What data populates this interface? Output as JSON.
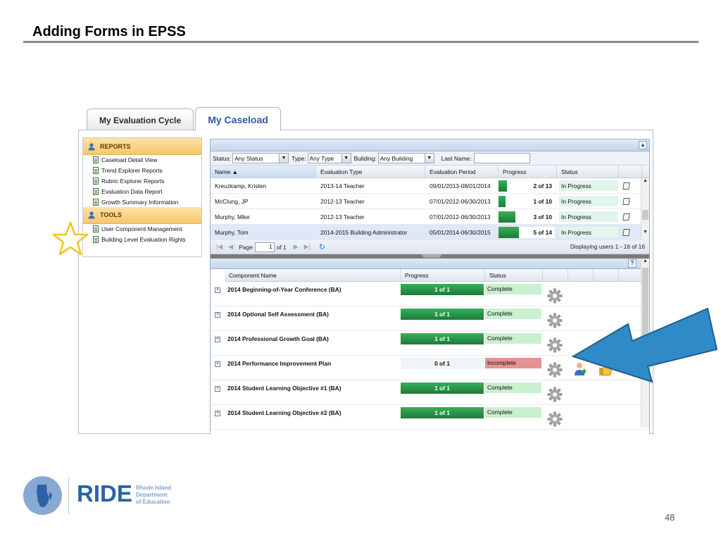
{
  "slide": {
    "title": "Adding Forms in EPSS",
    "page_number": "48"
  },
  "tabs": [
    {
      "label": "My Evaluation Cycle",
      "active": false
    },
    {
      "label": "My Caseload",
      "active": true
    }
  ],
  "sidebar": {
    "reports_header": "REPORTS",
    "reports": [
      "Caseload Detail View",
      "Trend Explorer Reports",
      "Rubric Explorer Reports",
      "Evaluation Data Report",
      "Growth Summary Information"
    ],
    "tools_header": "TOOLS",
    "tools": [
      "User Component Management",
      "Building Level Evaluation Rights"
    ]
  },
  "filters": {
    "status_label": "Status:",
    "status_value": "Any Status",
    "type_label": "Type:",
    "type_value": "Any Type",
    "building_label": "Building:",
    "building_value": "Any Building",
    "lastname_label": "Last Name:"
  },
  "caseload": {
    "columns": [
      "Name ▲",
      "Evaluation Type",
      "Evaluation Period",
      "Progress",
      "Status"
    ],
    "rows": [
      {
        "name": "Kreuzkamp, Kristen",
        "type": "2013-14 Teacher",
        "period": "09/01/2013-08/01/2014",
        "progress": "2 of 13",
        "progress_fraction": 0.154,
        "status": "In Progress"
      },
      {
        "name": "McClung, JP",
        "type": "2012-13 Teacher",
        "period": "07/01/2012-06/30/2013",
        "progress": "1 of 10",
        "progress_fraction": 0.1,
        "status": "In Progress"
      },
      {
        "name": "Murphy, Mike",
        "type": "2012-13 Teacher",
        "period": "07/01/2012-06/30/2013",
        "progress": "3 of 10",
        "progress_fraction": 0.3,
        "status": "In Progress"
      },
      {
        "name": "Murphy, Tom",
        "type": "2014-2015 Building Administrator",
        "period": "05/01/2014-06/30/2015",
        "progress": "5 of 14",
        "progress_fraction": 0.357,
        "status": "In Progress"
      }
    ]
  },
  "pager": {
    "page_label": "Page",
    "page_value": "1",
    "of_label": "of 1",
    "display_text": "Displaying users 1 - 16 of 16"
  },
  "components": {
    "help_label": "?",
    "columns": [
      "Component Name",
      "Progress",
      "Status"
    ],
    "rows": [
      {
        "name": "2014 Beginning-of-Year Conference (BA)",
        "progress": "1 of 1",
        "status": "Complete",
        "complete": true
      },
      {
        "name": "2014 Optional Self Assessment (BA)",
        "progress": "1 of 1",
        "status": "Complete",
        "complete": true
      },
      {
        "name": "2014 Professional Growth Goal (BA)",
        "progress": "1 of 1",
        "status": "Complete",
        "complete": true
      },
      {
        "name": "2014 Performance Improvement Plan",
        "progress": "0 of 1",
        "status": "Incomplete",
        "complete": false
      },
      {
        "name": "2014 Student Learning Objective #1 (BA)",
        "progress": "1 of 1",
        "status": "Complete",
        "complete": true
      },
      {
        "name": "2014 Student Learning Objective #2 (BA)",
        "progress": "1 of 1",
        "status": "Complete",
        "complete": true
      }
    ]
  },
  "logo": {
    "acronym": "RIDE",
    "line1": "Rhode Island",
    "line2": "Department",
    "line3": "of Education"
  },
  "colors": {
    "accent_blue": "#2f8ac8",
    "star_yellow": "#f3c623",
    "progress_green": "#1f8a45",
    "complete_green": "#c9f0cf",
    "incomplete_red": "#e49292"
  },
  "icons": {
    "row_action": "document-icon",
    "component_action": "gear-icon",
    "assign": "person-arrow-icon",
    "approve": "thumbs-up-icon",
    "annotation_star": "star-outline-icon",
    "annotation_arrow": "arrow-icon"
  }
}
